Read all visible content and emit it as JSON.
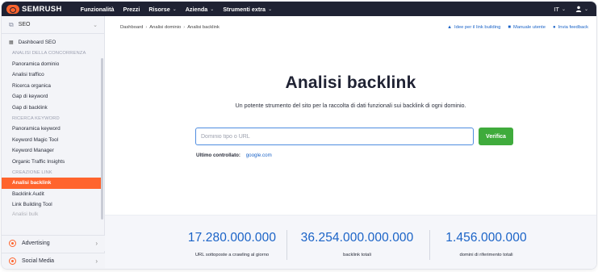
{
  "topbar": {
    "logo": "SEMRUSH",
    "nav": [
      {
        "label": "Funzionalità",
        "has_dropdown": false
      },
      {
        "label": "Prezzi",
        "has_dropdown": false
      },
      {
        "label": "Risorse",
        "has_dropdown": true
      },
      {
        "label": "Azienda",
        "has_dropdown": true
      },
      {
        "label": "Strumenti extra",
        "has_dropdown": true
      }
    ],
    "language": "IT",
    "icons": {
      "user": "user-icon",
      "chevron": "chevron-down-icon"
    }
  },
  "sidebar": {
    "header": "SEO",
    "dashboard": "Dashboard SEO",
    "sections": [
      {
        "title": "ANALISI DELLA CONCORRENZA",
        "items": [
          "Panoramica dominio",
          "Analisi traffico",
          "Ricerca organica",
          "Gap di keyword",
          "Gap di backlink"
        ]
      },
      {
        "title": "RICERCA KEYWORD",
        "items": [
          "Panoramica keyword",
          "Keyword Magic Tool",
          "Keyword Manager",
          "Organic Traffic Insights"
        ]
      },
      {
        "title": "CREAZIONE LINK",
        "items": [
          "Analisi backlink",
          "Backlink Audit",
          "Link Building Tool",
          "Analisi bulk"
        ]
      }
    ],
    "active_item": "Analisi backlink",
    "bottom": [
      {
        "label": "Advertising",
        "icon": "target-icon"
      },
      {
        "label": "Social Media",
        "icon": "speech-bubble-icon"
      }
    ]
  },
  "main": {
    "breadcrumb": [
      "Dashboard",
      "Analisi dominio",
      "Analisi backlink"
    ],
    "links": [
      {
        "label": "Idee per il link building",
        "icon": "megaphone-icon"
      },
      {
        "label": "Manuale utente",
        "icon": "book-icon"
      },
      {
        "label": "Invia feedback",
        "icon": "chat-icon"
      }
    ],
    "title": "Analisi backlink",
    "subtitle": "Un potente strumento del sito per la raccolta di dati funzionali sui backlink di ogni dominio.",
    "search": {
      "placeholder": "Dominio tipo o URL",
      "value": ""
    },
    "verify_label": "Verifica",
    "last_checked_label": "Ultimo controllato:",
    "last_checked_value": "google.com",
    "stats": [
      {
        "value": "17.280.000.000",
        "label": "URL sottoposte a crawling al giorno"
      },
      {
        "value": "36.254.000.000.000",
        "label": "backlink totali"
      },
      {
        "value": "1.456.000.000",
        "label": "domini di riferimento totali"
      }
    ]
  },
  "colors": {
    "brand": "#ff642d",
    "topbar": "#1f2233",
    "link": "#1a63c7",
    "button": "#3fab3c"
  }
}
